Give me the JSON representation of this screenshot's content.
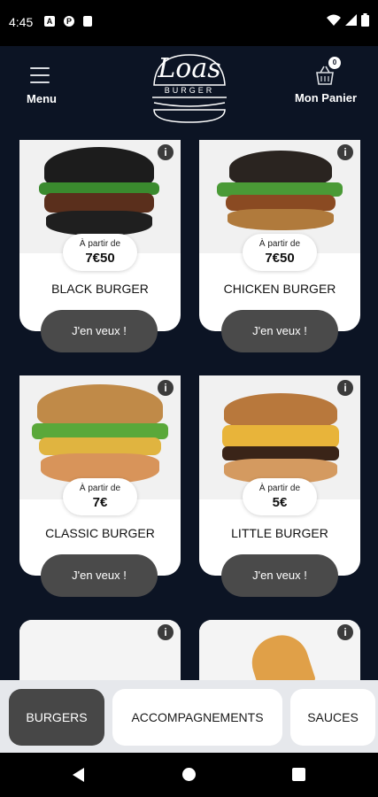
{
  "status_bar": {
    "time": "4:45",
    "notification_icons": [
      "a-icon",
      "p-icon",
      "sd-card-icon"
    ],
    "right_icons": [
      "wifi-icon",
      "signal-icon",
      "battery-icon"
    ]
  },
  "header": {
    "menu_label": "Menu",
    "logo_title": "Loas",
    "logo_subtitle": "BURGER",
    "cart_label": "Mon Panier",
    "cart_count": "0"
  },
  "products": [
    {
      "name": "BLACK BURGER",
      "price_prefix": "À partir de",
      "price": "7€50",
      "button_label": "J'en veux !"
    },
    {
      "name": "CHICKEN BURGER",
      "price_prefix": "À partir de",
      "price": "7€50",
      "button_label": "J'en veux !"
    },
    {
      "name": "CLASSIC BURGER",
      "price_prefix": "À partir de",
      "price": "7€",
      "button_label": "J'en veux !"
    },
    {
      "name": "LITTLE BURGER",
      "price_prefix": "À partir de",
      "price": "5€",
      "button_label": "J'en veux !"
    }
  ],
  "info_icon": "i",
  "categories": [
    {
      "label": "BURGERS",
      "active": true
    },
    {
      "label": "ACCOMPAGNEMENTS",
      "active": false
    },
    {
      "label": "SAUCES",
      "active": false
    }
  ],
  "colors": {
    "background": "#0c1424",
    "card": "#ffffff",
    "button": "#4a4a4a",
    "active_tab": "#474747",
    "tab_bar": "#e6e8ec"
  }
}
